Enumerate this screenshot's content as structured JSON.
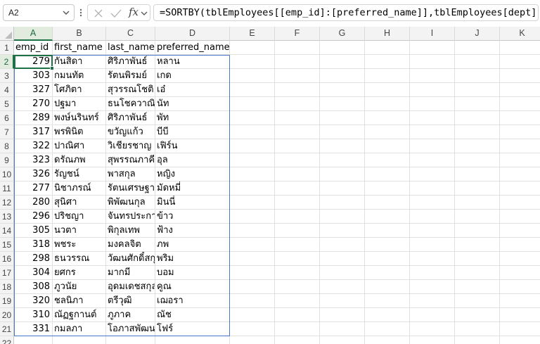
{
  "name_box": {
    "value": "A2"
  },
  "formula_bar": {
    "fx_label": "fx",
    "formula": "=SORTBY(tblEmployees[[emp_id]:[preferred_name]],tblEmployees[dept])"
  },
  "columns": [
    "A",
    "B",
    "C",
    "D",
    "E",
    "F",
    "G",
    "H",
    "I",
    "J",
    "K"
  ],
  "rows": [
    "1",
    "2",
    "3",
    "4",
    "5",
    "6",
    "7",
    "8",
    "9",
    "10",
    "11",
    "12",
    "13",
    "14",
    "15",
    "16",
    "17",
    "18",
    "19",
    "20",
    "21",
    "22"
  ],
  "active_cell": {
    "column": "A",
    "row": "2"
  },
  "table": {
    "headers": [
      "emp_id",
      "first_name",
      "last_name",
      "preferred_name"
    ],
    "records": [
      [
        "279",
        "กันสิดา",
        "ศิริภาพันธ์",
        "หลาน"
      ],
      [
        "303",
        "กมนทัต",
        "รัตนพิรมย์",
        "เกด"
      ],
      [
        "327",
        "โศภิตา",
        "สุวรรณโชติ",
        "เอ๋"
      ],
      [
        "270",
        "ปฐมา",
        "ธนโชควาณิ",
        "นัท"
      ],
      [
        "289",
        "พงษ์นรินทร์",
        "ศิริภาพันธ์",
        "พัท"
      ],
      [
        "317",
        "พรพินิต",
        "ขวัญแก้ว",
        "บีบี"
      ],
      [
        "322",
        "ปาณิศา",
        "วิเชียรชาญ",
        "เฟิร์น"
      ],
      [
        "323",
        "ดรัณภพ",
        "สุพรรณภาคี",
        "อุล"
      ],
      [
        "326",
        "รัญชน์",
        "พาสกุล",
        "หญิง"
      ],
      [
        "277",
        "นิชาภรณ์",
        "รัตนเศรษฐา",
        "มัดหมี่"
      ],
      [
        "280",
        "สุนิศา",
        "พิพัฒนกุล",
        "มินนี่"
      ],
      [
        "296",
        "ปริชญา",
        "จันทรประกา",
        "ข้าว"
      ],
      [
        "305",
        "นวตา",
        "พิกุลเทพ",
        "ฟ้าง"
      ],
      [
        "318",
        "พชระ",
        "มงคลจิต",
        "ภพ"
      ],
      [
        "298",
        "ธนวรรณ",
        "วัฒนศักดิ์สกุล",
        "พริม"
      ],
      [
        "304",
        "ยศกร",
        "มากมี",
        "บอม"
      ],
      [
        "308",
        "ภูวนัย",
        "อุดมเดชสกุล",
        "คูณ"
      ],
      [
        "320",
        "ชลนิภา",
        "ตรีวุฒิ",
        "เฌอรา"
      ],
      [
        "310",
        "ณัฏฐกานต์",
        "ภูภาค",
        "ณัช"
      ],
      [
        "331",
        "กมลภา",
        "โอภาสพัฒนา",
        "โฟร์"
      ]
    ]
  }
}
